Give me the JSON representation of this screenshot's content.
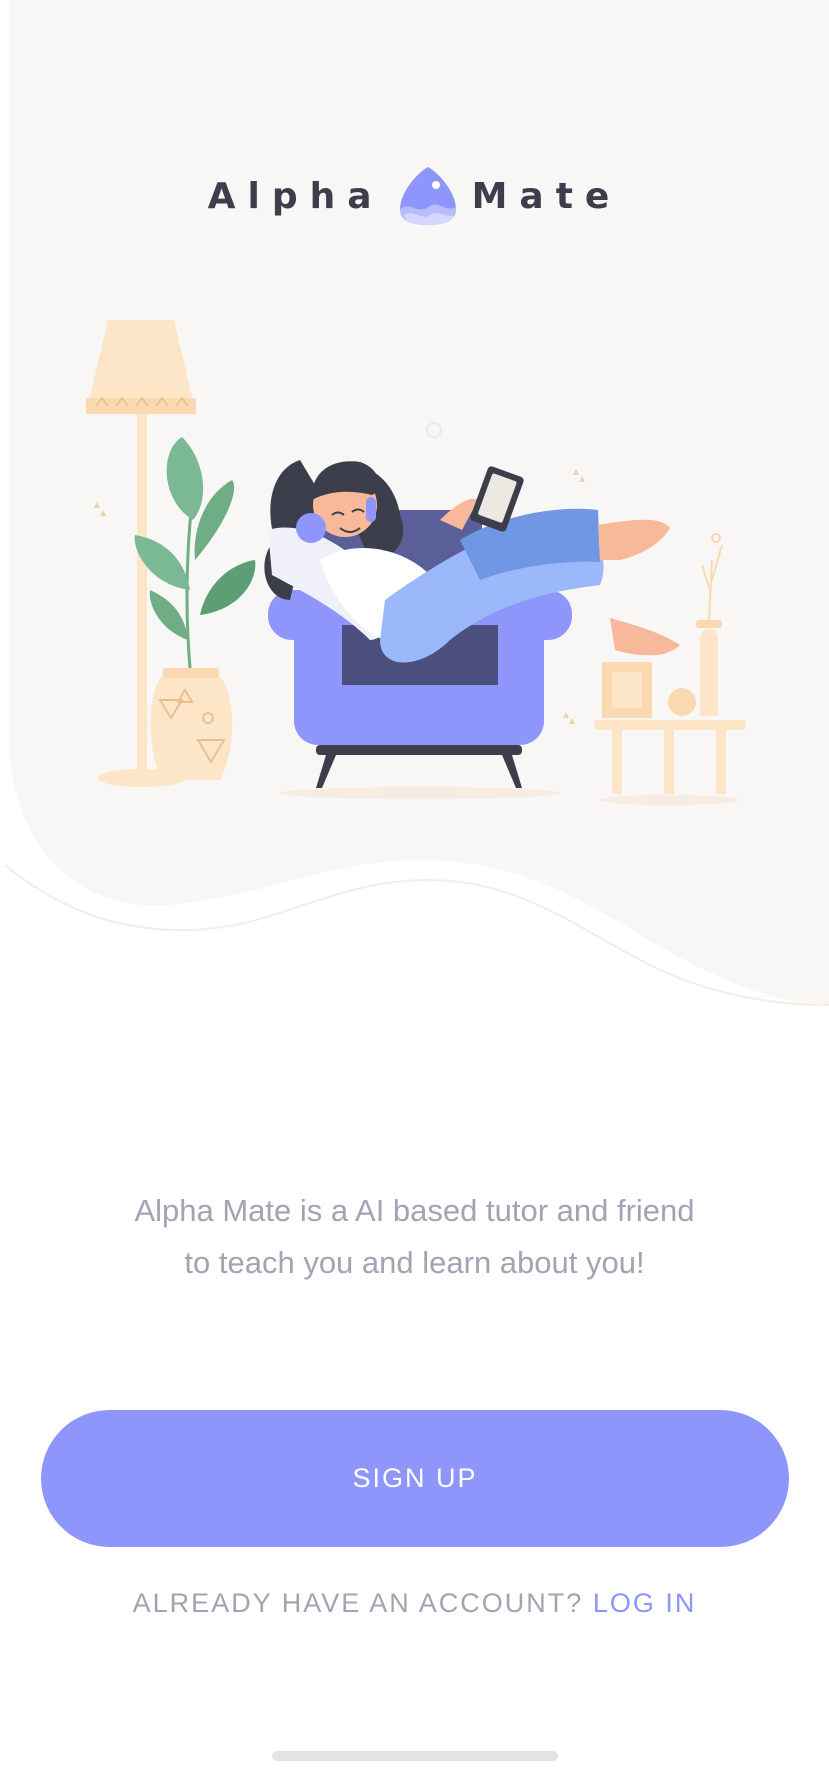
{
  "logo": {
    "word_left": "Alpha",
    "word_right": "Mate"
  },
  "tagline": {
    "line1": "Alpha Mate is a AI based tutor and friend",
    "line2": "to teach you and learn about you!"
  },
  "signup": {
    "label": "SIGN UP"
  },
  "login": {
    "prompt": "ALREADY HAVE AN ACCOUNT?",
    "link": "LOG IN"
  },
  "colors": {
    "accent": "#8e96fb",
    "hero_bg": "#f8f7f5",
    "text_muted": "#a3a3b3",
    "logo_text": "#3d3e4c"
  },
  "icons": {
    "logo_mark": "purple-droplet-logo-icon"
  }
}
